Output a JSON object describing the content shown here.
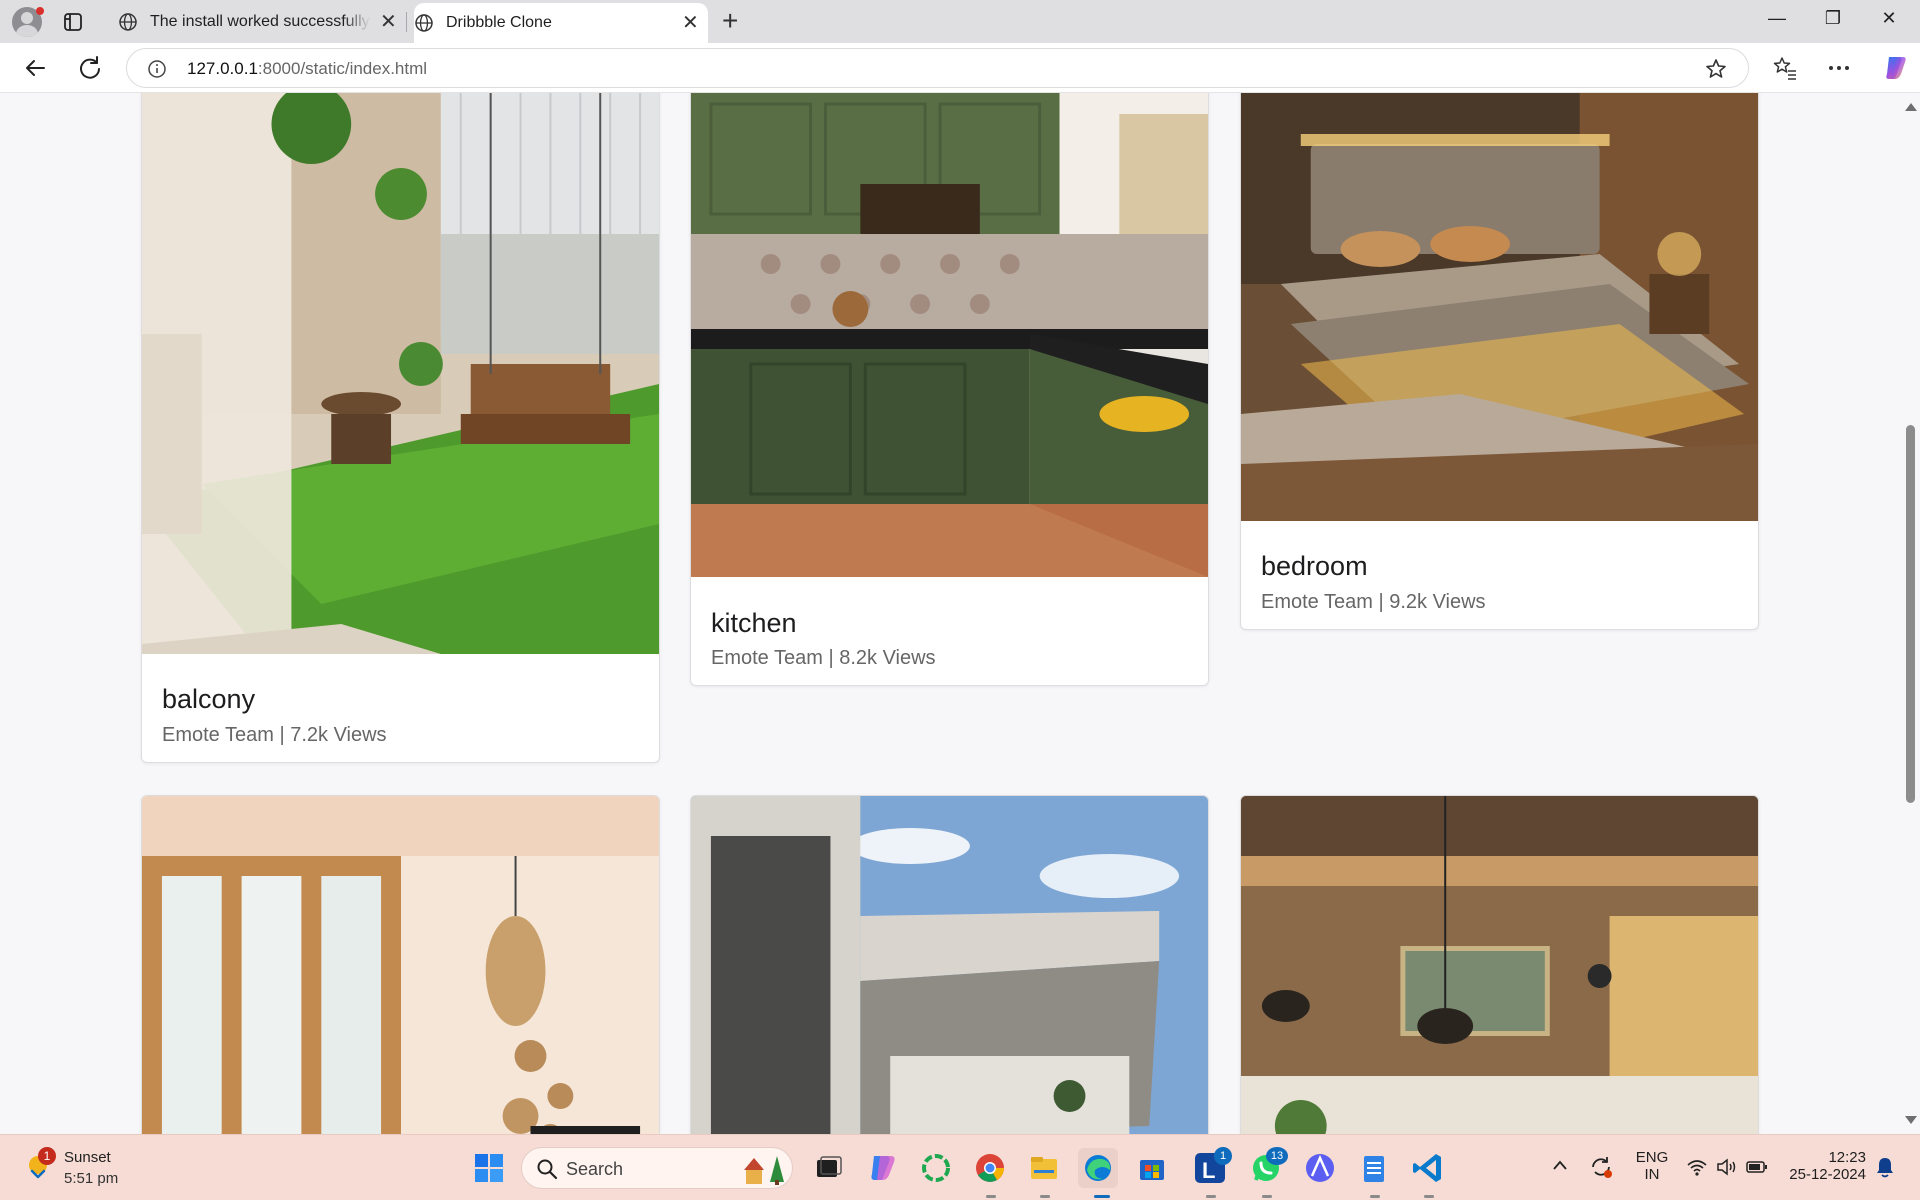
{
  "browser": {
    "tabs": [
      {
        "title": "The install worked successfully! Congratulations!",
        "active": false
      },
      {
        "title": "Dribbble Clone",
        "active": true
      }
    ],
    "address": {
      "host": "127.0.0.1",
      "path": ":8000/static/index.html"
    }
  },
  "cards_row1": [
    {
      "title": "balcony",
      "meta": "Emote Team | 7.2k Views"
    },
    {
      "title": "kitchen",
      "meta": "Emote Team | 8.2k Views"
    },
    {
      "title": "bedroom",
      "meta": "Emote Team | 9.2k Views"
    }
  ],
  "taskbar": {
    "weather": {
      "badge": "1",
      "title": "Sunset",
      "time": "5:51 pm"
    },
    "search_label": "Search",
    "badges": {
      "lens": "1",
      "whatsapp": "13"
    },
    "lang": {
      "line1": "ENG",
      "line2": "IN"
    },
    "clock": {
      "time": "12:23",
      "date": "25-12-2024"
    }
  },
  "colors": {
    "accent": "#0f6cbd",
    "taskbar_bg": "#f6dcd5",
    "page_bg": "#f7f7f9"
  },
  "icons": [
    "profile-icon",
    "tab-actions-icon",
    "globe-icon",
    "close-icon",
    "plus-icon",
    "minimize-icon",
    "maximize-icon",
    "back-icon",
    "reload-icon",
    "info-icon",
    "star-icon",
    "favorites-icon",
    "more-icon",
    "copilot-icon",
    "windows-start-icon",
    "search-icon"
  ]
}
